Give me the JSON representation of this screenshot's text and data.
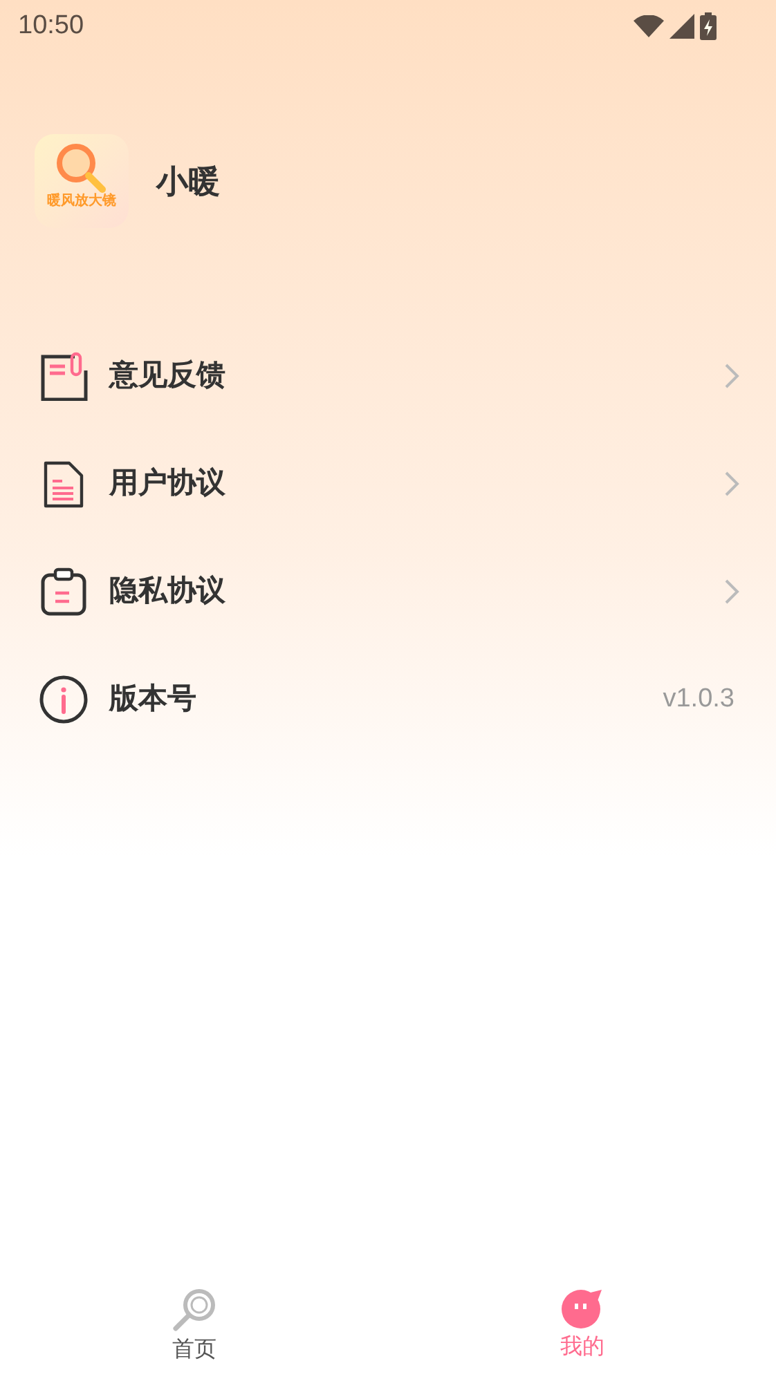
{
  "status_bar": {
    "time": "10:50"
  },
  "profile": {
    "app_icon_caption": "暖风放大镜",
    "name": "小暖"
  },
  "menu": [
    {
      "kind": "link",
      "label": "意见反馈"
    },
    {
      "kind": "link",
      "label": "用户协议"
    },
    {
      "kind": "link",
      "label": "隐私协议"
    },
    {
      "kind": "value",
      "label": "版本号",
      "value": "v1.0.3"
    }
  ],
  "tab_bar": [
    {
      "label": "首页",
      "selected": false
    },
    {
      "label": "我的",
      "selected": true
    }
  ]
}
